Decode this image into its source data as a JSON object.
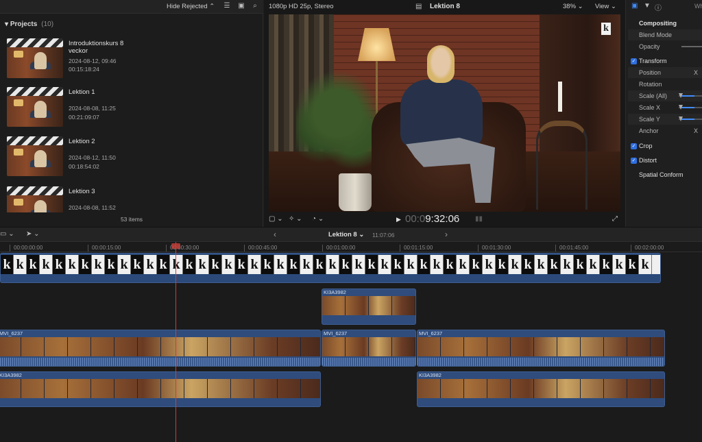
{
  "browser": {
    "hide_rejected_label": "Hide Rejected",
    "projects_label": "Projects",
    "projects_count": "(10)",
    "items_count": "53 items",
    "projects": [
      {
        "name": "Introduktionskurs 8 veckor",
        "date": "2024-08-12, 09:46",
        "duration": "00:15:18:24"
      },
      {
        "name": "Lektion 1",
        "date": "2024-08-08, 11:25",
        "duration": "00:21:09:07"
      },
      {
        "name": "Lektion 2",
        "date": "2024-08-12, 11:50",
        "duration": "00:18:54:02"
      },
      {
        "name": "Lektion 3",
        "date": "2024-08-08, 11:52",
        "duration": ""
      }
    ]
  },
  "viewer": {
    "format": "1080p HD 25p, Stereo",
    "title": "Lektion 8",
    "zoom": "38%",
    "view_label": "View",
    "timecode_dim": "00:0",
    "timecode": "9:32:06",
    "logo_letter": "k"
  },
  "inspector": {
    "who_label": "Wh",
    "rows": {
      "compositing": "Compositing",
      "blend_mode": "Blend Mode",
      "opacity": "Opacity",
      "transform": "Transform",
      "position": "Position",
      "rotation": "Rotation",
      "scale_all": "Scale (All)",
      "scale_x": "Scale X",
      "scale_y": "Scale Y",
      "anchor": "Anchor",
      "crop": "Crop",
      "distort": "Distort",
      "spatial_conform": "Spatial Conform"
    },
    "x_label": "X"
  },
  "timeline": {
    "project_name": "Lektion 8",
    "duration": "11:07:06",
    "ruler": [
      "00:00:00:00",
      "00:00:15:00",
      "00:00:30:00",
      "00:00:45:00",
      "00:01:00:00",
      "00:01:15:00",
      "00:01:30:00",
      "00:01:45:00",
      "00:02:00:00"
    ],
    "clips": {
      "connected_top": "KI3A3982",
      "primary_left": "MVI_6237",
      "primary_mid": "MVI_6237",
      "primary_right": "MVI_6237",
      "lower_left": "KI3A3982",
      "lower_right": "KI3A3982"
    },
    "logo_letter": "k"
  },
  "colors": {
    "accent": "#3f8cff",
    "playhead": "#c9403a",
    "clip": "#2f4c7c"
  }
}
